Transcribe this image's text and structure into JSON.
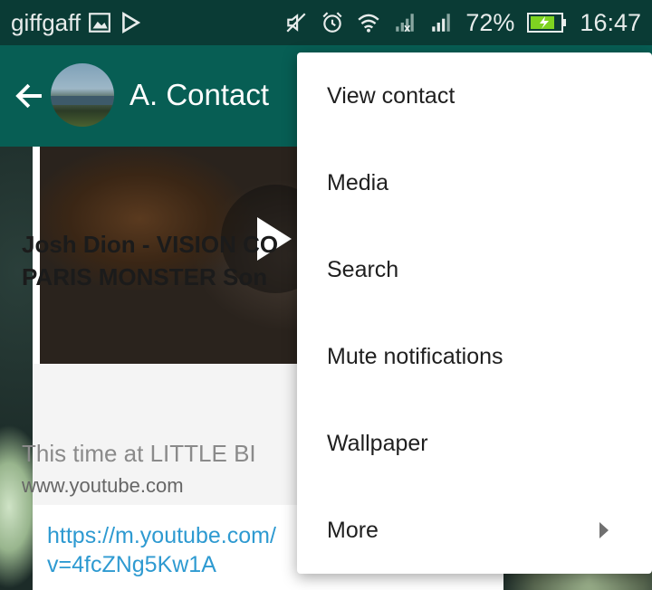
{
  "status_bar": {
    "carrier": "giffgaff",
    "battery_percent": "72%",
    "time": "16:47",
    "icons": [
      "gallery-icon",
      "play-store-icon",
      "mute-icon",
      "alarm-icon",
      "wifi-icon",
      "signal-no-service-icon",
      "signal-icon",
      "battery-charging-icon"
    ]
  },
  "app_bar": {
    "contact_name": "A. Contact"
  },
  "message": {
    "link_title": "Josh Dion - VISION CO PARIS MONSTER Son",
    "link_title_line1": "Josh Dion - VISION CO",
    "link_title_line2": "PARIS MONSTER Son",
    "link_desc": "This time at LITTLE BI",
    "link_domain": "www.youtube.com",
    "url_line1": "https://m.youtube.com/",
    "url_line2": "v=4fcZNg5Kw1A"
  },
  "menu": {
    "items": [
      {
        "label": "View contact"
      },
      {
        "label": "Media"
      },
      {
        "label": "Search"
      },
      {
        "label": "Mute notifications"
      },
      {
        "label": "Wallpaper"
      },
      {
        "label": "More",
        "has_submenu": true
      }
    ]
  }
}
